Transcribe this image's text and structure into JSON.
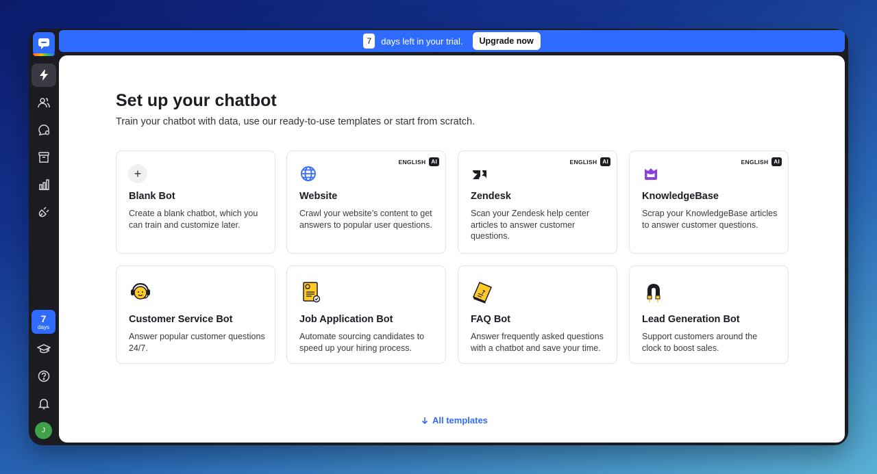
{
  "banner": {
    "days": "7",
    "trial_text": "days left in your trial.",
    "upgrade_label": "Upgrade now"
  },
  "sidebar": {
    "items": [
      {
        "name": "bolt-icon",
        "active": true
      },
      {
        "name": "users-icon"
      },
      {
        "name": "chat-icon"
      },
      {
        "name": "archive-icon"
      },
      {
        "name": "reports-icon"
      },
      {
        "name": "integrations-icon"
      }
    ],
    "trial_badge": {
      "num": "7",
      "unit": "days"
    },
    "bottom_items": [
      "academy-icon",
      "help-icon",
      "bell-icon"
    ],
    "avatar": "J"
  },
  "main": {
    "title": "Set up your chatbot",
    "subtitle": "Train your chatbot with data, use our ready-to-use templates or start from scratch.",
    "tag_text": "ENGLISH",
    "tag_ai": "AI",
    "cards": [
      {
        "title": "Blank Bot",
        "desc": "Create a blank chatbot, which you can train and customize later.",
        "icon": "plus-icon"
      },
      {
        "title": "Website",
        "desc": "Crawl your website’s content to get answers to popular user questions.",
        "icon": "globe-icon"
      },
      {
        "title": "Zendesk",
        "desc": "Scan your Zendesk help center articles to answer customer questions.",
        "icon": "zendesk-icon"
      },
      {
        "title": "KnowledgeBase",
        "desc": "Scrap your KnowledgeBase articles to answer customer questions.",
        "icon": "knowledgebase-icon"
      },
      {
        "title": "Customer Service Bot",
        "desc": "Answer popular customer questions 24/7.",
        "icon": "headset-icon"
      },
      {
        "title": "Job Application Bot",
        "desc": "Automate sourcing candidates to speed up your hiring process.",
        "icon": "document-icon"
      },
      {
        "title": "FAQ Bot",
        "desc": "Answer frequently asked questions with a chatbot and save your time.",
        "icon": "faq-icon"
      },
      {
        "title": "Lead Generation Bot",
        "desc": "Support customers around the clock to boost sales.",
        "icon": "magnet-icon"
      }
    ],
    "all_templates_label": "All templates"
  },
  "colors": {
    "accent": "#2f6bff",
    "sidebar_bg": "#1b1b22",
    "icon_yellow": "#ffc928",
    "kb_purple": "#8b3fe0"
  }
}
